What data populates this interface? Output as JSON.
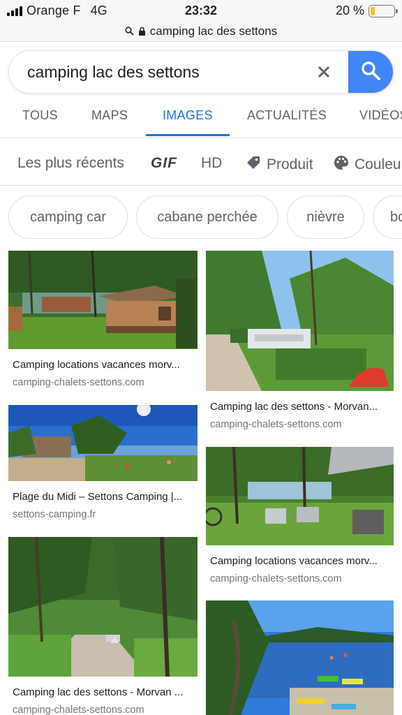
{
  "status_bar": {
    "carrier": "Orange F",
    "network": "4G",
    "time": "23:32",
    "battery_percent": "20 %",
    "battery_level": 0.2,
    "battery_color": "#f5c518"
  },
  "url_bar": {
    "url": "camping lac des settons",
    "icons": [
      "search-icon",
      "lock-icon"
    ]
  },
  "search": {
    "query": "camping lac des settons",
    "clear_icon": "close-icon",
    "button_icon": "search-icon",
    "button_color": "#4285f4"
  },
  "tabs": [
    {
      "label": "TOUS"
    },
    {
      "label": "MAPS"
    },
    {
      "label": "IMAGES",
      "active": true
    },
    {
      "label": "ACTUALITÉS"
    },
    {
      "label": "VIDÉOS"
    }
  ],
  "accent_color": "#1a73e8",
  "filters": [
    {
      "label": "Les plus récents"
    },
    {
      "label": "GIF"
    },
    {
      "label": "HD"
    },
    {
      "label": "Produit",
      "icon": "tag-icon"
    },
    {
      "label": "Couleur",
      "icon": "palette-icon"
    }
  ],
  "chips": [
    "camping car",
    "cabane perchée",
    "nièvre",
    "bo"
  ],
  "results": [
    {
      "title": "Camping locations vacances morv...",
      "source": "camping-chalets-settons.com"
    },
    {
      "title": "Plage du Midi – Settons Camping |...",
      "source": "settons-camping.fr"
    },
    {
      "title": "Camping lac des settons - Morvan ...",
      "source": "camping-chalets-settons.com"
    },
    {
      "title": "Camping lac des settons - Morvan...",
      "source": "camping-chalets-settons.com"
    },
    {
      "title": "Camping locations vacances morv...",
      "source": "camping-chalets-settons.com"
    },
    {
      "title": "",
      "source": ""
    }
  ]
}
